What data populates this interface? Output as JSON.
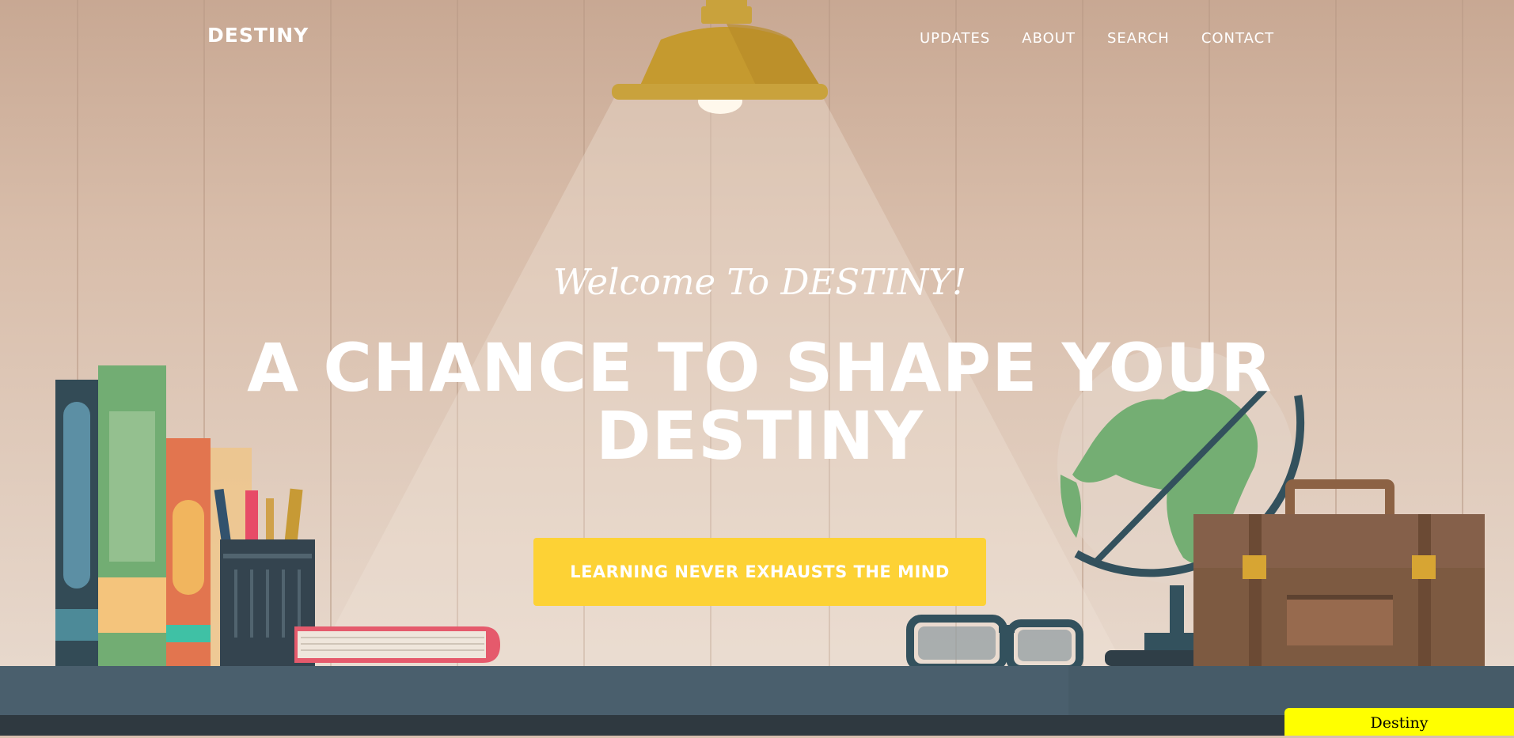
{
  "header": {
    "brand": "DESTINY",
    "nav": [
      {
        "label": "UPDATES"
      },
      {
        "label": "ABOUT"
      },
      {
        "label": "SEARCH"
      },
      {
        "label": "CONTACT"
      }
    ]
  },
  "hero": {
    "welcome": "Welcome To DESTINY!",
    "headline_line1": "A CHANCE TO SHAPE YOUR",
    "headline_line2": "DESTINY",
    "cta": "LEARNING NEVER EXHAUSTS THE MIND"
  },
  "badge": {
    "text": "Destiny"
  },
  "colors": {
    "accent": "#fdd235",
    "desk": "#4a5f6d",
    "badge": "#ffff00"
  }
}
